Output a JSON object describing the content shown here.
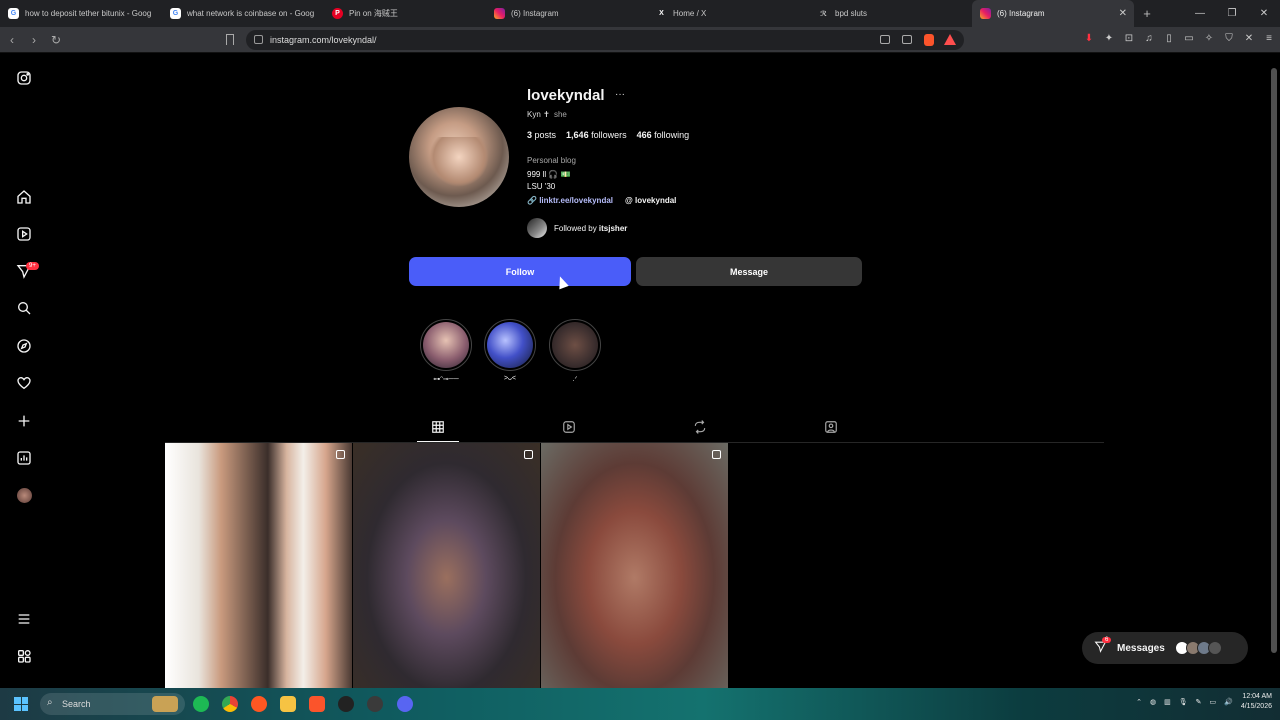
{
  "browser": {
    "tabs": [
      {
        "label": "how to deposit tether bitunix - Goog",
        "icon": "google-icon",
        "active": false
      },
      {
        "label": "what network is coinbase on - Goog",
        "icon": "google-icon",
        "active": false
      },
      {
        "label": "Pin on 海贼王",
        "icon": "pinterest-icon",
        "active": false
      },
      {
        "label": "(6) Instagram",
        "icon": "instagram-icon",
        "active": false
      },
      {
        "label": "Home / X",
        "icon": "x-icon",
        "active": false
      },
      {
        "label": "bpd sluts",
        "icon": "site-icon",
        "active": false
      },
      {
        "label": "(6) Instagram",
        "icon": "instagram-icon",
        "active": true
      }
    ],
    "url": "instagram.com/lovekyndal/"
  },
  "profile": {
    "username": "lovekyndal",
    "name": "Kyn",
    "name_symbol": "✝",
    "pronouns": "she",
    "posts_count": "3",
    "posts_label": "posts",
    "followers_count": "1,646",
    "followers_label": "followers",
    "following_count": "466",
    "following_label": "following",
    "category": "Personal blog",
    "bio_line1": "999 ll 🎧 💵",
    "bio_line2": "LSU '30",
    "link": "linktr.ee/lovekyndal",
    "threads": "lovekyndal",
    "followed_by_prefix": "Followed by",
    "followed_by_user": "itsjsher"
  },
  "actions": {
    "follow_label": "Follow",
    "message_label": "Message"
  },
  "highlights": [
    {
      "label": "⊶ᵔ⊸──"
    },
    {
      "label": ">ᴗ<"
    },
    {
      "label": ".ᐟ"
    }
  ],
  "nav": {
    "notifications_badge": "9+"
  },
  "messages": {
    "label": "Messages",
    "badge": "6"
  },
  "taskbar": {
    "search_placeholder": "Search",
    "time": "12:04 AM",
    "date": "4/15/2026"
  },
  "colors": {
    "follow_button": "#4a5df9",
    "message_button": "#363636",
    "link": "#b6bdfa",
    "badge": "#ff3040"
  }
}
